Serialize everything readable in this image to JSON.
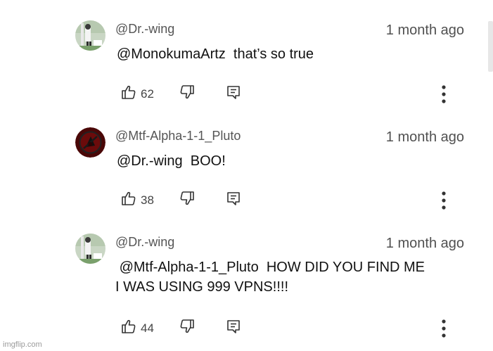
{
  "comments": [
    {
      "author": "@Dr.-wing",
      "time": "1 month ago",
      "text": "@MonokumaArtz  that’s so true",
      "likes": "62",
      "avatar": "dr-wing-avatar"
    },
    {
      "author": "@Mtf-Alpha-1-1_Pluto",
      "time": "1 month ago",
      "text": "@Dr.-wing  BOO!",
      "likes": "38",
      "avatar": "pluto-avatar"
    },
    {
      "author": "@Dr.-wing",
      "time": "1 month ago",
      "text": " @Mtf-Alpha-1-1_Pluto  HOW DID YOU FIND ME\nI WAS USING 999 VPNS!!!!",
      "likes": "44",
      "avatar": "dr-wing-avatar"
    }
  ],
  "watermark": "imgflip.com",
  "colors": {
    "text": "#111111",
    "meta": "#555555",
    "avatar_red": "#5a0a0a"
  }
}
